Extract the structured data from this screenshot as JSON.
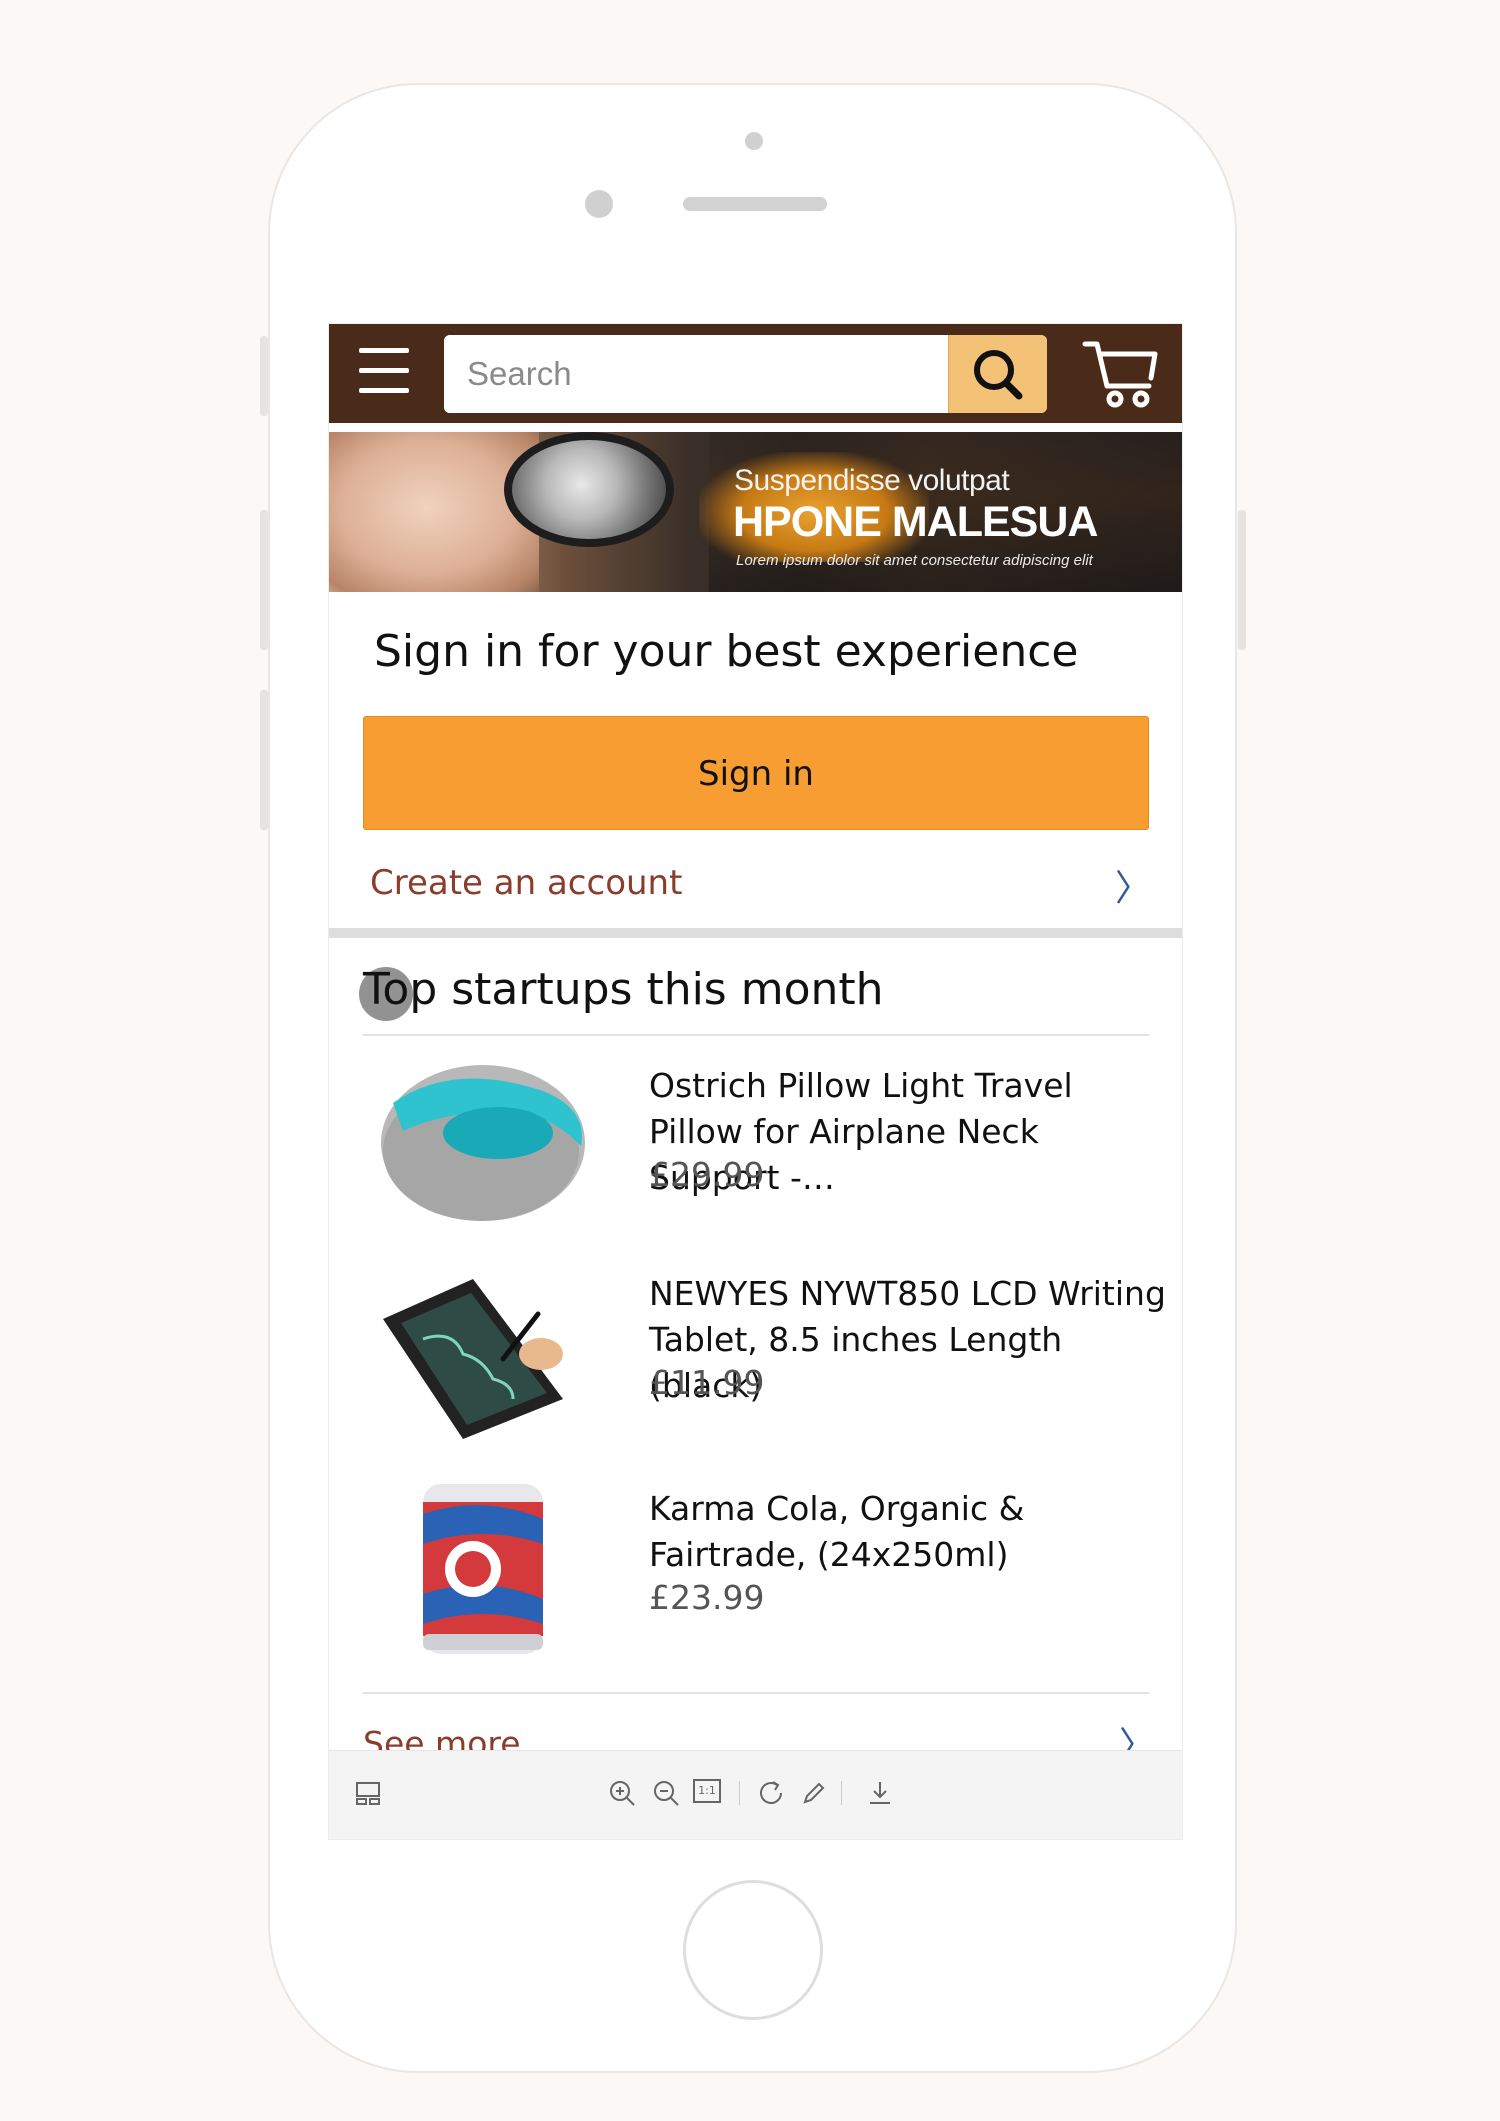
{
  "header": {
    "search_placeholder": "Search",
    "menu_icon": "hamburger-menu-icon",
    "search_icon": "magnifier-icon",
    "cart_icon": "shopping-cart-icon"
  },
  "banner": {
    "subtitle": "Suspendisse volutpat",
    "title": "HPONE MALESUA",
    "description": "Lorem ipsum dolor sit amet consectetur adipiscing elit"
  },
  "signin": {
    "heading": "Sign in for your best experience",
    "button_label": "Sign in",
    "create_account_label": "Create an account",
    "chevron": "〉"
  },
  "startups": {
    "title": "Top startups this month",
    "products": [
      {
        "name": "Ostrich Pillow Light Travel Pillow for Airplane Neck Support -…",
        "price": "£29.99",
        "image_icon": "travel-pillow-image"
      },
      {
        "name": "NEWYES NYWT850 LCD Writing Tablet, 8.5 inches Length (black)",
        "price": "£11.99",
        "image_icon": "writing-tablet-image"
      },
      {
        "name": "Karma Cola, Organic & Fairtrade, (24x250ml)",
        "price": "£23.99",
        "image_icon": "cola-can-image"
      }
    ],
    "see_more_label": "See more",
    "see_more_chevron": "〉"
  },
  "viewer_toolbar": {
    "icons": [
      "thumbnail-view-icon",
      "zoom-in-icon",
      "zoom-out-icon",
      "actual-size-icon",
      "rotate-icon",
      "edit-icon",
      "download-icon"
    ],
    "actual_size_label": "1:1"
  },
  "colors": {
    "header_bg": "#4a2a18",
    "search_button": "#f3c277",
    "signin_button": "#f79d32",
    "link_text": "#8a3d2c",
    "chevron": "#2d5a9a"
  }
}
